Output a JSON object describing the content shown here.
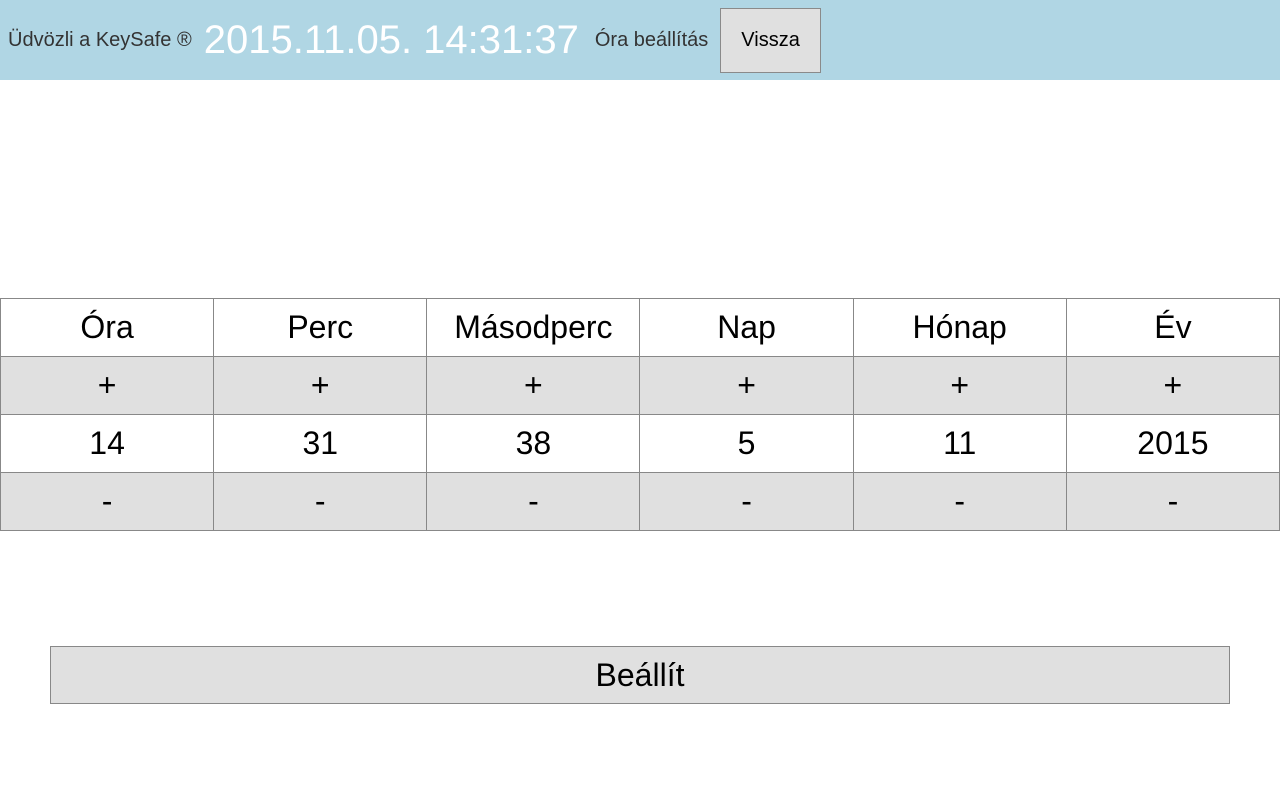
{
  "header": {
    "welcome": "Üdvözli a KeySafe ®",
    "datetime": "2015.11.05. 14:31:37",
    "page_title": "Óra beállítás",
    "back_label": "Vissza"
  },
  "columns": [
    {
      "label": "Óra",
      "value": "14"
    },
    {
      "label": "Perc",
      "value": "31"
    },
    {
      "label": "Másodperc",
      "value": "38"
    },
    {
      "label": "Nap",
      "value": "5"
    },
    {
      "label": "Hónap",
      "value": "11"
    },
    {
      "label": "Év",
      "value": "2015"
    }
  ],
  "symbols": {
    "plus": "+",
    "minus": "-"
  },
  "set_label": "Beállít"
}
